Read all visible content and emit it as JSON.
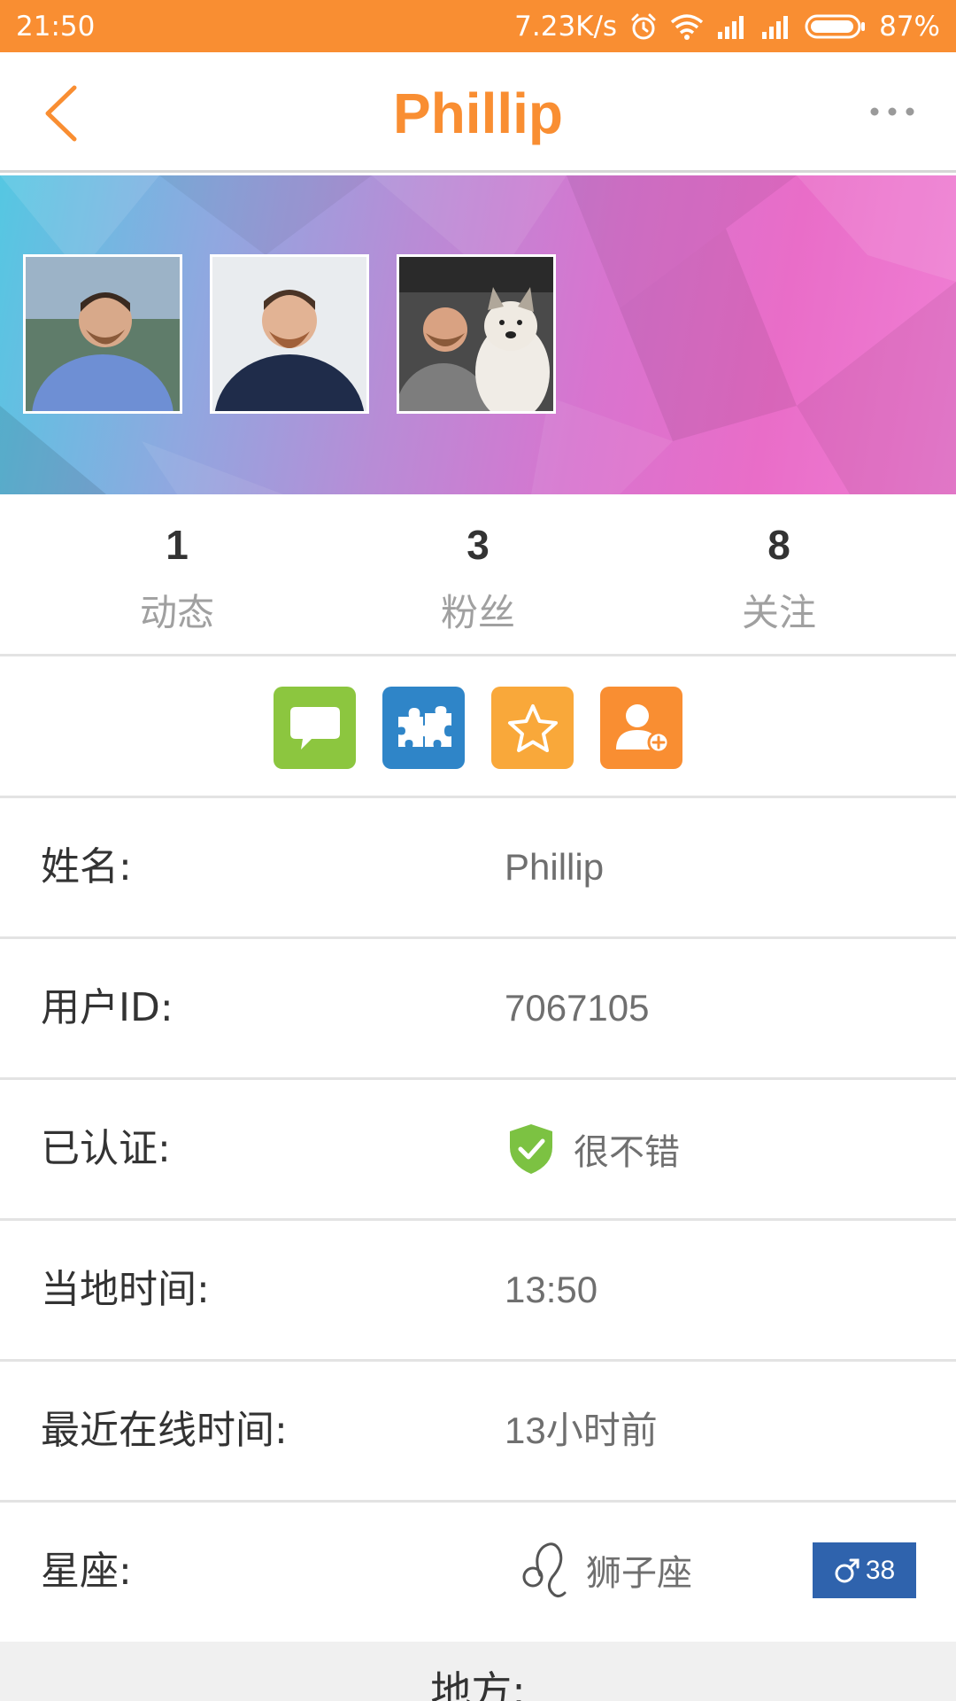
{
  "status_bar": {
    "time": "21:50",
    "net_speed": "7.23K/s",
    "battery": "87%",
    "icons": [
      "alarm-icon",
      "wifi-icon",
      "signal-icon",
      "signal-icon",
      "battery-icon"
    ]
  },
  "header": {
    "title": "Phillip",
    "back_icon": "chevron-left-icon",
    "menu_icon": "more-icon"
  },
  "photos": [
    "profile-photo-1",
    "profile-photo-2",
    "profile-photo-3-with-dog"
  ],
  "stats": [
    {
      "count": "1",
      "label": "动态"
    },
    {
      "count": "3",
      "label": "粉丝"
    },
    {
      "count": "8",
      "label": "关注"
    }
  ],
  "actions": [
    {
      "icon": "chat-bubble-icon",
      "color": "#8cc63f"
    },
    {
      "icon": "puzzle-icon",
      "color": "#2f85c8"
    },
    {
      "icon": "star-icon",
      "color": "#f9a83a"
    },
    {
      "icon": "add-user-icon",
      "color": "#f98e32"
    }
  ],
  "info": {
    "name_label": "姓名:",
    "name_value": "Phillip",
    "id_label": "用户ID:",
    "id_value": "7067105",
    "verified_label": "已认证:",
    "verified_value": "很不错",
    "local_time_label": "当地时间:",
    "local_time_value": "13:50",
    "last_online_label": "最近在线时间:",
    "last_online_value": "13小时前",
    "zodiac_label": "星座:",
    "zodiac_value": "狮子座",
    "age": "38"
  },
  "bottom": {
    "title": "地方:"
  },
  "colors": {
    "accent": "#f98e32",
    "verified": "#7cc242",
    "gender_badge": "#2f63ad"
  }
}
